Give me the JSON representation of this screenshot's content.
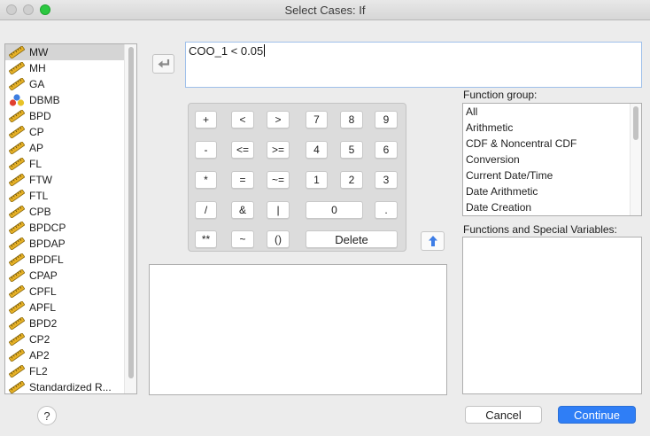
{
  "window": {
    "title": "Select Cases: If"
  },
  "variables": [
    {
      "name": "MW",
      "type": "scale"
    },
    {
      "name": "MH",
      "type": "scale"
    },
    {
      "name": "GA",
      "type": "scale"
    },
    {
      "name": "DBMB",
      "type": "nominal"
    },
    {
      "name": "BPD",
      "type": "scale"
    },
    {
      "name": "CP",
      "type": "scale"
    },
    {
      "name": "AP",
      "type": "scale"
    },
    {
      "name": "FL",
      "type": "scale"
    },
    {
      "name": "FTW",
      "type": "scale"
    },
    {
      "name": "FTL",
      "type": "scale"
    },
    {
      "name": "CPB",
      "type": "scale"
    },
    {
      "name": "BPDCP",
      "type": "scale"
    },
    {
      "name": "BPDAP",
      "type": "scale"
    },
    {
      "name": "BPDFL",
      "type": "scale"
    },
    {
      "name": "CPAP",
      "type": "scale"
    },
    {
      "name": "CPFL",
      "type": "scale"
    },
    {
      "name": "APFL",
      "type": "scale"
    },
    {
      "name": "BPD2",
      "type": "scale"
    },
    {
      "name": "CP2",
      "type": "scale"
    },
    {
      "name": "AP2",
      "type": "scale"
    },
    {
      "name": "FL2",
      "type": "scale"
    },
    {
      "name": "Standardized R...",
      "type": "scale"
    }
  ],
  "selected_variable": "MW",
  "expression": {
    "value": "COO_1 < 0.05"
  },
  "keypad": {
    "keys": [
      {
        "label": "+",
        "id": "plus"
      },
      {
        "label": "<",
        "id": "lt"
      },
      {
        "label": ">",
        "id": "gt"
      },
      {
        "label": "7",
        "id": "7"
      },
      {
        "label": "8",
        "id": "8"
      },
      {
        "label": "9",
        "id": "9"
      },
      {
        "label": "-",
        "id": "minus"
      },
      {
        "label": "<=",
        "id": "le"
      },
      {
        "label": ">=",
        "id": "ge"
      },
      {
        "label": "4",
        "id": "4"
      },
      {
        "label": "5",
        "id": "5"
      },
      {
        "label": "6",
        "id": "6"
      },
      {
        "label": "*",
        "id": "mult"
      },
      {
        "label": "=",
        "id": "eq"
      },
      {
        "label": "~=",
        "id": "ne"
      },
      {
        "label": "1",
        "id": "1"
      },
      {
        "label": "2",
        "id": "2"
      },
      {
        "label": "3",
        "id": "3"
      },
      {
        "label": "/",
        "id": "div"
      },
      {
        "label": "&",
        "id": "and"
      },
      {
        "label": "|",
        "id": "or"
      },
      {
        "label": "0",
        "id": "0"
      },
      {
        "label": ".",
        "id": "dot"
      },
      {
        "label": "**",
        "id": "pow"
      },
      {
        "label": "~",
        "id": "not"
      },
      {
        "label": "()",
        "id": "paren"
      },
      {
        "label": "Delete",
        "id": "delete"
      }
    ]
  },
  "function_group": {
    "label": "Function group:",
    "items": [
      "All",
      "Arithmetic",
      "CDF & Noncentral CDF",
      "Conversion",
      "Current Date/Time",
      "Date Arithmetic",
      "Date Creation"
    ]
  },
  "functions": {
    "label": "Functions and Special Variables:"
  },
  "buttons": {
    "help": "?",
    "cancel": "Cancel",
    "continue": "Continue"
  },
  "colors": {
    "accent": "#2f7ef6",
    "selection": "#d5d5d5",
    "ruler_icon": "#e8b227"
  }
}
